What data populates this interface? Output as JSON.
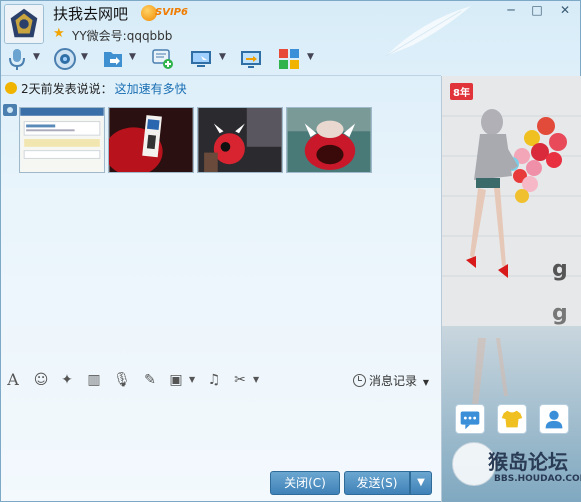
{
  "header": {
    "title": "扶我去网吧",
    "vip_badge": "SVIP6",
    "subtitle": "YY微会号:qqqbbb"
  },
  "window_controls": {
    "minimize": "─",
    "maximize": "□",
    "close": "✕"
  },
  "toolbar": {
    "items": [
      {
        "icon": "microphone-icon"
      },
      {
        "icon": "video-icon"
      },
      {
        "icon": "file-transfer-icon"
      },
      {
        "icon": "add-message-icon"
      },
      {
        "icon": "remote-desktop-icon"
      },
      {
        "icon": "screen-share-icon"
      },
      {
        "icon": "apps-icon"
      }
    ]
  },
  "status": {
    "prefix": "2天前发表说说：",
    "link": "这加速有多快"
  },
  "photos": [
    {
      "name": "photo-1",
      "subject": "screenshot"
    },
    {
      "name": "photo-2",
      "subject": "ticket"
    },
    {
      "name": "photo-3",
      "subject": "red-mascot"
    },
    {
      "name": "photo-4",
      "subject": "red-mascot-closeup"
    }
  ],
  "right_panel": {
    "badge": "8年",
    "watermark_text": "猴岛论坛",
    "watermark_sub": "BBS.HOUDAO.COM"
  },
  "input_toolbar": {
    "history_label": "消息记录"
  },
  "buttons": {
    "close": "关闭(C)",
    "send": "发送(S)",
    "send_dropdown": "▼"
  },
  "colors": {
    "accent": "#3f82b8",
    "link": "#1a6fb3",
    "badge": "#e0343a"
  }
}
